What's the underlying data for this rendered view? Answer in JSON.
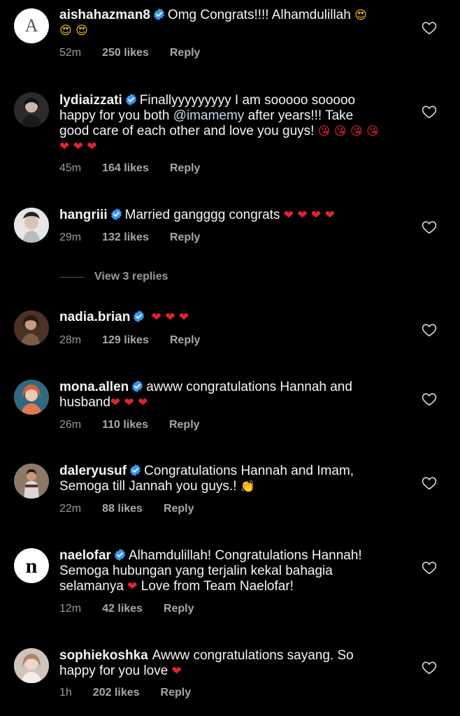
{
  "comments": [
    {
      "user": "aishahazman8",
      "text": "Omg Congrats!!!! Alhamdulillah",
      "emojis": "😍 😍 😍",
      "time": "52m",
      "likes": "250 likes",
      "reply": "Reply"
    },
    {
      "user": "lydiaizzati",
      "text": "Finallyyyyyyyyy I am sooooo sooooo happy for you both",
      "mention": "@imamemy",
      "text2": "after years!!! Take good care of each other and love you guys!",
      "emojis": "😘 😘 😘 😘 ❤ ❤ ❤",
      "time": "45m",
      "likes": "164 likes",
      "reply": "Reply"
    },
    {
      "user": "hangriii",
      "text": "Married gangggg congrats",
      "emojis": "❤ ❤ ❤ ❤",
      "time": "29m",
      "likes": "132 likes",
      "reply": "Reply"
    },
    {
      "user": "nadia.brian",
      "text": "",
      "emojis": "❤ ❤ ❤",
      "time": "28m",
      "likes": "129 likes",
      "reply": "Reply"
    },
    {
      "user": "mona.allen",
      "text": "awww congratulations Hannah and husband",
      "emojis": "❤ ❤ ❤",
      "time": "26m",
      "likes": "110 likes",
      "reply": "Reply"
    },
    {
      "user": "daleryusuf",
      "text": "Congratulations Hannah and Imam, Semoga till Jannah you guys.!",
      "emojis": "👏",
      "time": "22m",
      "likes": "88 likes",
      "reply": "Reply"
    },
    {
      "user": "naelofar",
      "text": "Alhamdulillah! Congratulations Hannah! Semoga hubungan yang terjalin kekal bahagia selamanya",
      "emojis": "❤",
      "text2": "Love from Team Naelofar!",
      "time": "12m",
      "likes": "42 likes",
      "reply": "Reply"
    },
    {
      "user": "sophiekoshka",
      "text": "Awww congratulations sayang. So happy for you love",
      "emojis": "❤",
      "time": "1h",
      "likes": "202 likes",
      "reply": "Reply"
    }
  ],
  "view_replies": "View 3 replies",
  "colors": {
    "background": "#000000",
    "verified": "#3897f0",
    "heart": "#e0242c"
  }
}
